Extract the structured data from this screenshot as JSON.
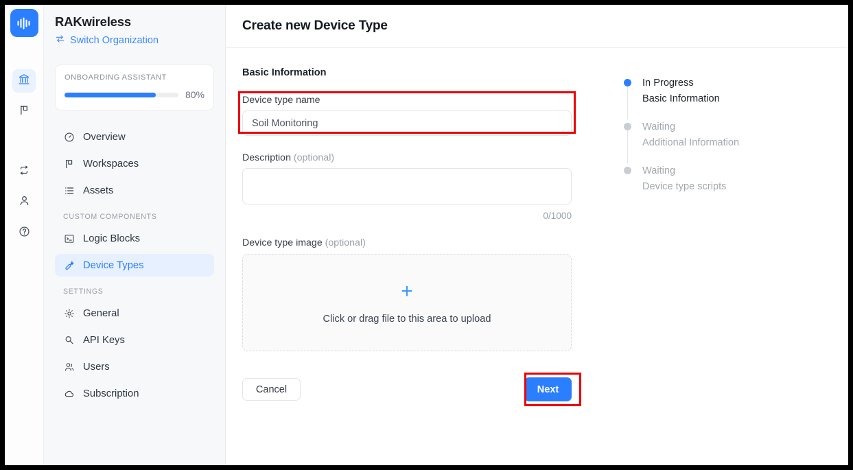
{
  "rail": {
    "logo_icon": "waveform-logo-icon",
    "items": [
      {
        "name": "organization-icon",
        "icon": "bank",
        "active": true
      },
      {
        "name": "flag-icon",
        "icon": "flag",
        "active": false
      },
      {
        "name": "sync-icon",
        "icon": "repeat",
        "active": false
      },
      {
        "name": "user-icon",
        "icon": "person",
        "active": false
      },
      {
        "name": "help-icon",
        "icon": "question-circle",
        "active": false
      }
    ]
  },
  "sidebar": {
    "org_name": "RAKwireless",
    "switch_org_label": "Switch Organization",
    "onboarding": {
      "title": "ONBOARDING ASSISTANT",
      "percent_label": "80%",
      "percent_value": 80
    },
    "nav": [
      {
        "label": "Overview",
        "icon": "gauge-icon",
        "active": false
      },
      {
        "label": "Workspaces",
        "icon": "flag-icon",
        "active": false
      },
      {
        "label": "Assets",
        "icon": "list-icon",
        "active": false
      }
    ],
    "custom_components_label": "CUSTOM COMPONENTS",
    "custom_components": [
      {
        "label": "Logic Blocks",
        "icon": "terminal-icon",
        "active": false
      },
      {
        "label": "Device Types",
        "icon": "wrench-icon",
        "active": true
      }
    ],
    "settings_label": "SETTINGS",
    "settings": [
      {
        "label": "General",
        "icon": "gear-icon",
        "active": false
      },
      {
        "label": "API Keys",
        "icon": "key-icon",
        "active": false
      },
      {
        "label": "Users",
        "icon": "users-icon",
        "active": false
      },
      {
        "label": "Subscription",
        "icon": "cloud-icon",
        "active": false
      }
    ]
  },
  "main": {
    "title": "Create new Device Type",
    "section_title": "Basic Information",
    "device_name": {
      "label": "Device type name",
      "value": "Soil Monitoring",
      "placeholder": ""
    },
    "description": {
      "label": "Description",
      "optional": "(optional)",
      "value": "",
      "placeholder": "",
      "counter": "0/1000"
    },
    "device_image": {
      "label": "Device type image",
      "optional": "(optional)",
      "plus_icon": "plus-icon",
      "dropzone_text": "Click or drag file to this area to upload"
    },
    "cancel_label": "Cancel",
    "next_label": "Next"
  },
  "steps": [
    {
      "status": "In Progress",
      "name": "Basic Information",
      "active": true
    },
    {
      "status": "Waiting",
      "name": "Additional Information",
      "active": false
    },
    {
      "status": "Waiting",
      "name": "Device type scripts",
      "active": false
    }
  ],
  "colors": {
    "accent": "#2b7fff",
    "highlight": "#ef0000",
    "sidebar_bg": "#f7f8fa",
    "active_nav_bg": "#e7f0fe",
    "muted_text": "#a2a8b0"
  }
}
